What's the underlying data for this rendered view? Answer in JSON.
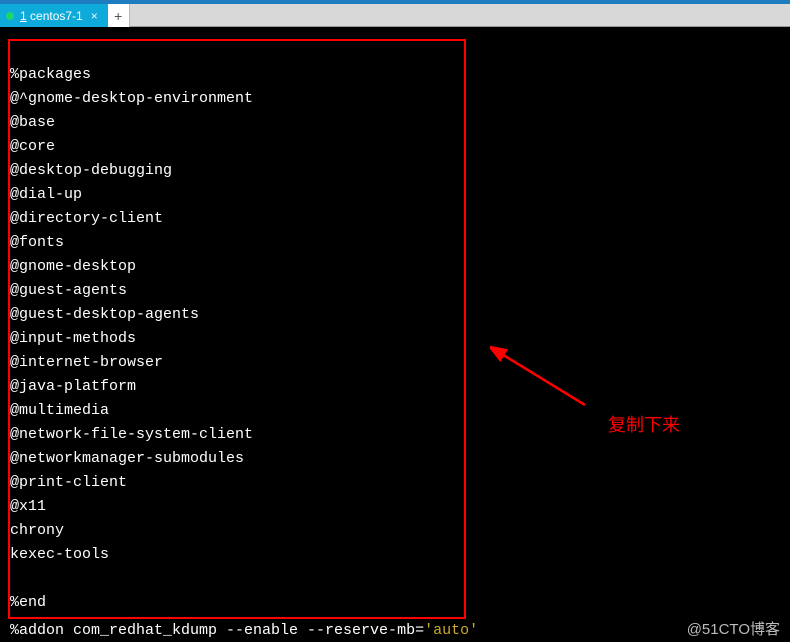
{
  "tab": {
    "number": "1",
    "label": "centos7-1"
  },
  "new_tab_label": "+",
  "packages": {
    "header": "%packages",
    "lines": [
      "@^gnome-desktop-environment",
      "@base",
      "@core",
      "@desktop-debugging",
      "@dial-up",
      "@directory-client",
      "@fonts",
      "@gnome-desktop",
      "@guest-agents",
      "@guest-desktop-agents",
      "@input-methods",
      "@internet-browser",
      "@java-platform",
      "@multimedia",
      "@network-file-system-client",
      "@networkmanager-submodules",
      "@print-client",
      "@x11",
      "chrony",
      "kexec-tools"
    ],
    "footer": "%end"
  },
  "addon": {
    "prefix": "%addon com_redhat_kdump --enable --reserve-mb=",
    "quote": "'",
    "value": "auto"
  },
  "annotation": "复制下来",
  "watermark": "@51CTO博客"
}
